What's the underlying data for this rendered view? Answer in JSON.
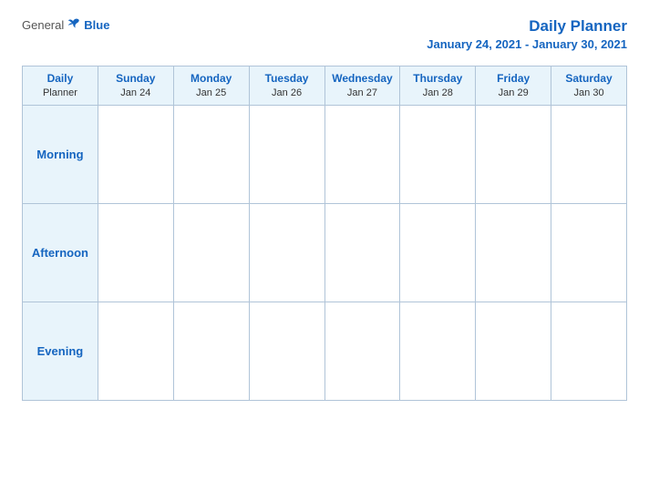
{
  "logo": {
    "general": "General",
    "blue": "Blue"
  },
  "header": {
    "title": "Daily Planner",
    "date_range": "January 24, 2021 - January 30, 2021"
  },
  "table": {
    "header_label_line1": "Daily",
    "header_label_line2": "Planner",
    "columns": [
      {
        "day": "Sunday",
        "date": "Jan 24"
      },
      {
        "day": "Monday",
        "date": "Jan 25"
      },
      {
        "day": "Tuesday",
        "date": "Jan 26"
      },
      {
        "day": "Wednesday",
        "date": "Jan 27"
      },
      {
        "day": "Thursday",
        "date": "Jan 28"
      },
      {
        "day": "Friday",
        "date": "Jan 29"
      },
      {
        "day": "Saturday",
        "date": "Jan 30"
      }
    ],
    "rows": [
      {
        "label": "Morning"
      },
      {
        "label": "Afternoon"
      },
      {
        "label": "Evening"
      }
    ]
  }
}
